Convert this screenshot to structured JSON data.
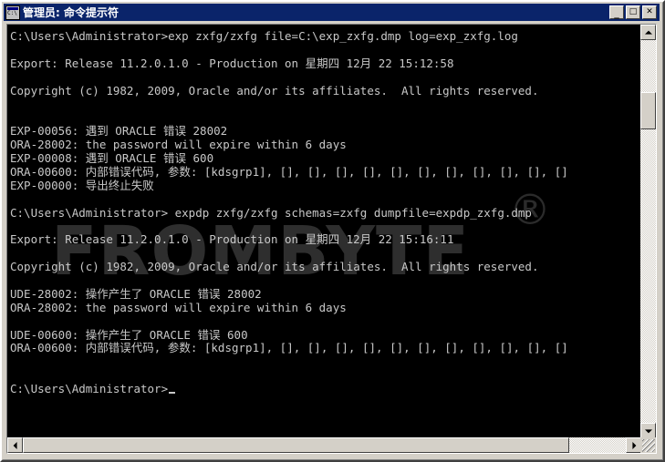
{
  "window": {
    "title": "管理员: 命令提示符",
    "icon": "console-icon",
    "buttons": {
      "minimize": "_",
      "maximize": "□",
      "close": "✕"
    }
  },
  "watermark": {
    "text": "FROMBYTE",
    "registered_mark": "®"
  },
  "console": {
    "background_color": "#000000",
    "text_color": "#c8c8c8",
    "prompt": "C:\\Users\\Administrator>",
    "lines": [
      "C:\\Users\\Administrator>exp zxfg/zxfg file=C:\\exp_zxfg.dmp log=exp_zxfg.log",
      "",
      "Export: Release 11.2.0.1.0 - Production on 星期四 12月 22 15:12:58",
      "",
      "Copyright (c) 1982, 2009, Oracle and/or its affiliates.  All rights reserved.",
      "",
      "",
      "EXP-00056: 遇到 ORACLE 错误 28002",
      "ORA-28002: the password will expire within 6 days",
      "EXP-00008: 遇到 ORACLE 错误 600",
      "ORA-00600: 内部错误代码, 参数: [kdsgrp1], [], [], [], [], [], [], [], [], [], [], []",
      "EXP-00000: 导出终止失败",
      "",
      "C:\\Users\\Administrator> expdp zxfg/zxfg schemas=zxfg dumpfile=expdp_zxfg.dmp",
      "",
      "Export: Release 11.2.0.1.0 - Production on 星期四 12月 22 15:16:11",
      "",
      "Copyright (c) 1982, 2009, Oracle and/or its affiliates.  All rights reserved.",
      "",
      "UDE-28002: 操作产生了 ORACLE 错误 28002",
      "ORA-28002: the password will expire within 6 days",
      "",
      "UDE-00600: 操作产生了 ORACLE 错误 600",
      "ORA-00600: 内部错误代码, 参数: [kdsgrp1], [], [], [], [], [], [], [], [], [], [], []",
      "",
      "",
      "C:\\Users\\Administrator>"
    ],
    "cursor_visible": true
  },
  "scrollbars": {
    "vertical": {
      "up_arrow": "▲",
      "down_arrow": "▼"
    },
    "horizontal": {
      "left_arrow": "◀",
      "right_arrow": "▶"
    }
  }
}
